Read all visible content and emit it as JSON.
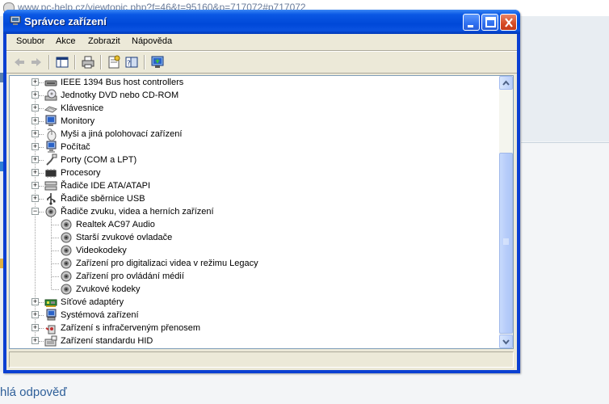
{
  "background": {
    "url_text": "www.pc-help.cz/viewtopic.php?f=46&t=95160&p=717072#p717072",
    "bottom_link": "hlá odpověď"
  },
  "window": {
    "title": "Správce zařízení",
    "controls": {
      "minimize_icon": "minimize-icon",
      "maximize_icon": "maximize-icon",
      "close_icon": "close-icon"
    }
  },
  "menu": [
    "Soubor",
    "Akce",
    "Zobrazit",
    "Nápověda"
  ],
  "toolbar": {
    "buttons": [
      "back-icon",
      "forward-icon",
      "show-hide-tree-icon",
      "print-icon",
      "properties-icon",
      "help-icon",
      "update-driver-icon"
    ]
  },
  "tree": {
    "items": [
      {
        "label": "IEEE 1394 Bus host controllers",
        "icon": "ieee1394-icon",
        "level": 0,
        "expander": "+"
      },
      {
        "label": "Jednotky DVD nebo CD-ROM",
        "icon": "cdrom-icon",
        "level": 0,
        "expander": "+"
      },
      {
        "label": "Klávesnice",
        "icon": "keyboard-icon",
        "level": 0,
        "expander": "+"
      },
      {
        "label": "Monitory",
        "icon": "monitor-icon",
        "level": 0,
        "expander": "+"
      },
      {
        "label": "Myši a jiná polohovací zařízení",
        "icon": "mouse-icon",
        "level": 0,
        "expander": "+"
      },
      {
        "label": "Počítač",
        "icon": "computer-icon",
        "level": 0,
        "expander": "+"
      },
      {
        "label": "Porty (COM a LPT)",
        "icon": "port-icon",
        "level": 0,
        "expander": "+"
      },
      {
        "label": "Procesory",
        "icon": "processor-icon",
        "level": 0,
        "expander": "+"
      },
      {
        "label": "Řadiče IDE ATA/ATAPI",
        "icon": "ide-controller-icon",
        "level": 0,
        "expander": "+"
      },
      {
        "label": "Řadiče sběrnice USB",
        "icon": "usb-icon",
        "level": 0,
        "expander": "+"
      },
      {
        "label": "Řadiče zvuku, videa a herních zařízení",
        "icon": "sound-icon",
        "level": 0,
        "expander": "−"
      },
      {
        "label": "Realtek AC97 Audio",
        "icon": "sound-icon",
        "level": 1,
        "expander": ""
      },
      {
        "label": "Starší zvukové ovladače",
        "icon": "sound-icon",
        "level": 1,
        "expander": ""
      },
      {
        "label": "Videokodeky",
        "icon": "sound-icon",
        "level": 1,
        "expander": ""
      },
      {
        "label": "Zařízení pro digitalizaci videa v režimu Legacy",
        "icon": "sound-icon",
        "level": 1,
        "expander": ""
      },
      {
        "label": "Zařízení pro ovládání médií",
        "icon": "sound-icon",
        "level": 1,
        "expander": ""
      },
      {
        "label": "Zvukové kodeky",
        "icon": "sound-icon",
        "level": 1,
        "expander": ""
      },
      {
        "label": "Síťové adaptéry",
        "icon": "network-adapter-icon",
        "level": 0,
        "expander": "+"
      },
      {
        "label": "Systémová zařízení",
        "icon": "system-device-icon",
        "level": 0,
        "expander": "+"
      },
      {
        "label": "Zařízení s infračerveným přenosem",
        "icon": "infrared-icon",
        "level": 0,
        "expander": "+"
      },
      {
        "label": "Zařízení standardu HID",
        "icon": "hid-icon",
        "level": 0,
        "expander": "+"
      }
    ]
  },
  "colors": {
    "titlebar": "#0a58e4",
    "client": "#ece9d8",
    "link": "#2e5f99"
  }
}
